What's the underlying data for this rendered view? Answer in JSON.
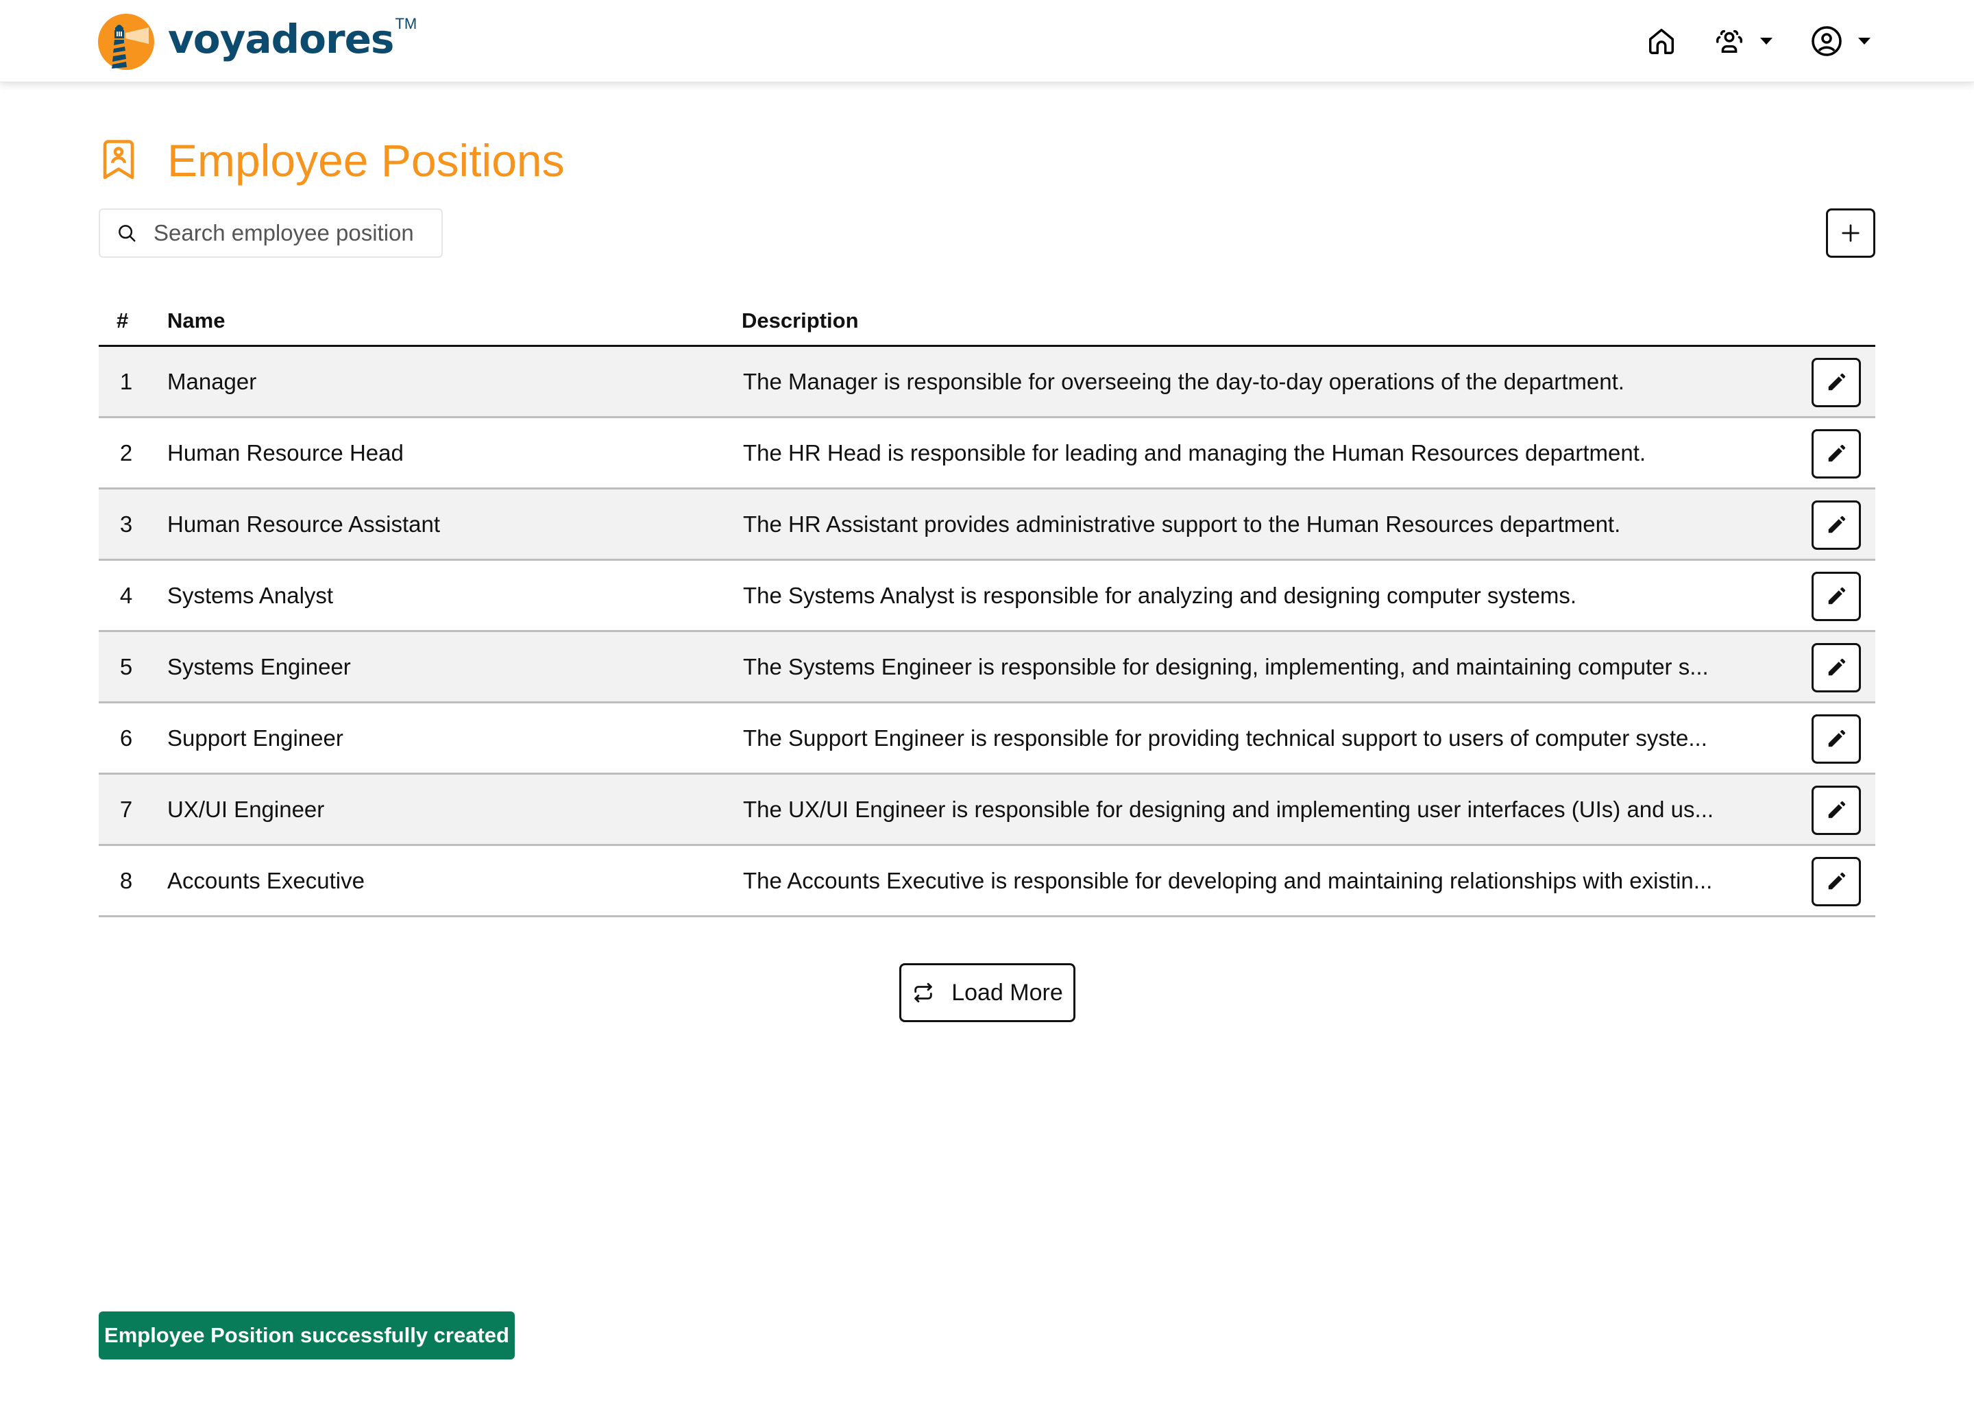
{
  "app": {
    "brand_name": "voyadores",
    "brand_trademark": "TM",
    "colors": {
      "brand_orange": "#f7941d",
      "brand_navy": "#0c4a6e",
      "success_green": "#087c58",
      "row_stripe": "#f2f2f2"
    }
  },
  "nav": {
    "home_icon": "home-icon",
    "team_icon": "team-icon",
    "profile_icon": "user-circle-icon"
  },
  "page": {
    "title": "Employee Positions",
    "title_icon": "badge-person-icon"
  },
  "search": {
    "placeholder": "Search employee position",
    "value": ""
  },
  "toolbar": {
    "add_icon": "plus-icon"
  },
  "table": {
    "columns": [
      "#",
      "Name",
      "Description"
    ],
    "rows": [
      {
        "num": "1",
        "name": "Manager",
        "description": "The Manager is responsible for overseeing the day-to-day operations of the department."
      },
      {
        "num": "2",
        "name": "Human Resource Head",
        "description": "The HR Head is responsible for leading and managing the Human Resources department."
      },
      {
        "num": "3",
        "name": "Human Resource Assistant",
        "description": "The HR Assistant provides administrative support to the Human Resources department."
      },
      {
        "num": "4",
        "name": "Systems Analyst",
        "description": "The Systems Analyst is responsible for analyzing and designing computer systems."
      },
      {
        "num": "5",
        "name": "Systems Engineer",
        "description": "The Systems Engineer is responsible for designing, implementing, and maintaining computer s..."
      },
      {
        "num": "6",
        "name": "Support Engineer",
        "description": "The Support Engineer is responsible for providing technical support to users of computer syste..."
      },
      {
        "num": "7",
        "name": "UX/UI Engineer",
        "description": "The UX/UI Engineer is responsible for designing and implementing user interfaces (UIs) and us..."
      },
      {
        "num": "8",
        "name": "Accounts Executive",
        "description": "The Accounts Executive is responsible for developing and maintaining relationships with existin..."
      }
    ]
  },
  "pagination": {
    "load_more_label": "Load More"
  },
  "toast": {
    "message": "Employee Position successfully created"
  }
}
